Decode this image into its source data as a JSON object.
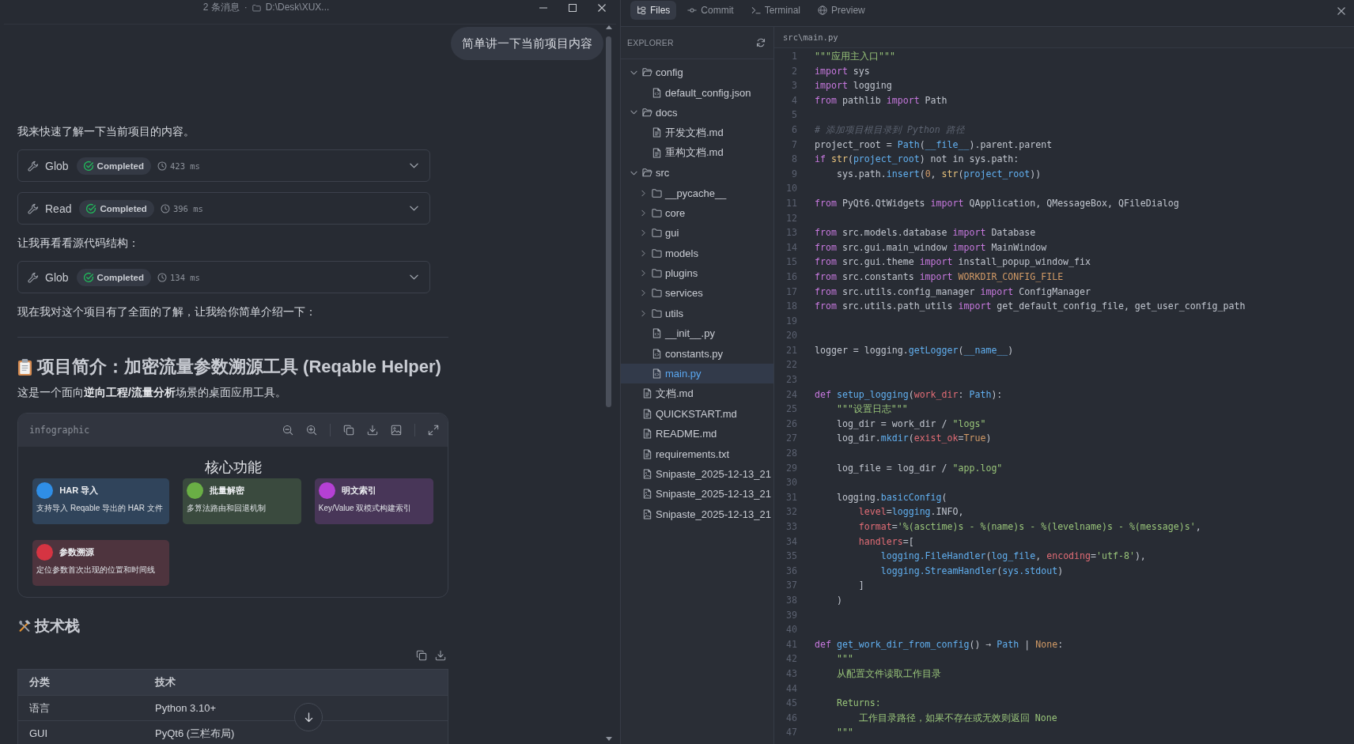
{
  "window": {
    "message_count": "2 条消息",
    "separator": "·",
    "path": "D:\\Desk\\XUX..."
  },
  "chat": {
    "user_message": "简单讲一下当前项目内容",
    "blocks": [
      {
        "kind": "text",
        "text": "我来快速了解一下当前项目的内容。"
      },
      {
        "kind": "tool",
        "name": "Glob",
        "status": "Completed",
        "duration": "423 ms",
        "expanded": false
      },
      {
        "kind": "tool",
        "name": "Read",
        "status": "Completed",
        "duration": "396 ms",
        "expanded": false
      },
      {
        "kind": "text",
        "text": "让我再看看源代码结构："
      },
      {
        "kind": "tool",
        "name": "Glob",
        "status": "Completed",
        "duration": "134 ms",
        "expanded": false
      },
      {
        "kind": "text",
        "text": "现在我对这个项目有了全面的了解，让我给你简单介绍一下："
      }
    ],
    "overview": {
      "heading": "项目简介：加密流量参数溯源工具 (Reqable Helper)",
      "intro": "这是一个面向**逆向工程/流量分析**场景的桌面应用工具。",
      "infographic": {
        "label": "infographic",
        "title": "核心功能",
        "features": [
          {
            "title": "HAR 导入",
            "description": "支持导入 Reqable 导出的 HAR 文件",
            "color": "#2f8ee6"
          },
          {
            "title": "批量解密",
            "description": "多算法路由和回退机制",
            "color": "#6aaf45"
          },
          {
            "title": "明文索引",
            "description": "Key/Value 双模式构建索引",
            "color": "#b540d4"
          },
          {
            "title": "参数溯源",
            "description": "定位参数首次出现的位置和时间线",
            "color": "#d63442"
          }
        ]
      }
    },
    "tech_stack": {
      "heading": "技术栈",
      "table": {
        "columns": [
          "分类",
          "技术"
        ],
        "rows": [
          [
            "语言",
            "Python 3.10+"
          ],
          [
            "GUI",
            "PyQt6 (三栏布局)"
          ]
        ]
      }
    }
  },
  "ide": {
    "tabs": [
      {
        "label": "Files",
        "selected": true
      },
      {
        "label": "Commit",
        "selected": false
      },
      {
        "label": "Terminal",
        "selected": false
      },
      {
        "label": "Preview",
        "selected": false
      }
    ],
    "explorer": {
      "title": "EXPLORER",
      "tree": [
        {
          "name": "config",
          "kind": "folder",
          "expanded": true,
          "selected": false,
          "children": [
            {
              "name": "default_config.json",
              "kind": "source",
              "selected": false
            }
          ]
        },
        {
          "name": "docs",
          "kind": "folder",
          "expanded": true,
          "selected": false,
          "children": [
            {
              "name": "开发文档.md",
              "kind": "document",
              "selected": false
            },
            {
              "name": "重构文档.md",
              "kind": "document",
              "selected": false
            }
          ]
        },
        {
          "name": "src",
          "kind": "folder",
          "expanded": true,
          "selected": false,
          "children": [
            {
              "name": "__pycache__",
              "kind": "folder",
              "expanded": false,
              "selected": false
            },
            {
              "name": "core",
              "kind": "folder",
              "expanded": false,
              "selected": false
            },
            {
              "name": "gui",
              "kind": "folder",
              "expanded": false,
              "selected": false
            },
            {
              "name": "models",
              "kind": "folder",
              "expanded": false,
              "selected": false
            },
            {
              "name": "plugins",
              "kind": "folder",
              "expanded": false,
              "selected": false
            },
            {
              "name": "services",
              "kind": "folder",
              "expanded": false,
              "selected": false
            },
            {
              "name": "utils",
              "kind": "folder",
              "expanded": false,
              "selected": false
            },
            {
              "name": "__init__.py",
              "kind": "source",
              "selected": false
            },
            {
              "name": "constants.py",
              "kind": "source",
              "selected": false
            },
            {
              "name": "main.py",
              "kind": "source",
              "selected": true
            }
          ]
        },
        {
          "name": "文档.md",
          "kind": "document",
          "selected": false
        },
        {
          "name": "QUICKSTART.md",
          "kind": "document",
          "selected": false
        },
        {
          "name": "README.md",
          "kind": "document",
          "selected": false
        },
        {
          "name": "requirements.txt",
          "kind": "document",
          "selected": false
        },
        {
          "name": "Snipaste_2025-12-13_21",
          "kind": "image",
          "selected": false
        },
        {
          "name": "Snipaste_2025-12-13_21",
          "kind": "image",
          "selected": false
        },
        {
          "name": "Snipaste_2025-12-13_21",
          "kind": "image",
          "selected": false
        }
      ]
    },
    "editor": {
      "path": "src\\main.py",
      "lines": [
        {
          "number": "1",
          "tokens": [
            {
              "text": "\"\"\"应用主入口\"\"\"",
              "kind": "string"
            }
          ]
        },
        {
          "number": "2",
          "tokens": [
            {
              "text": "import",
              "kind": "keyword"
            },
            {
              "text": " sys",
              "kind": "plain"
            }
          ]
        },
        {
          "number": "3",
          "tokens": [
            {
              "text": "import",
              "kind": "keyword"
            },
            {
              "text": " logging",
              "kind": "plain"
            }
          ]
        },
        {
          "number": "4",
          "tokens": [
            {
              "text": "from",
              "kind": "keyword"
            },
            {
              "text": " pathlib ",
              "kind": "plain"
            },
            {
              "text": "import",
              "kind": "keyword"
            },
            {
              "text": " Path",
              "kind": "plain"
            }
          ]
        },
        {
          "number": "5"
        },
        {
          "number": "6",
          "tokens": [
            {
              "text": "# 添加项目根目录到 Python 路径",
              "kind": "comment"
            }
          ]
        },
        {
          "number": "7",
          "tokens": [
            {
              "text": "project_root = ",
              "kind": "plain"
            },
            {
              "text": "Path",
              "kind": "function"
            },
            {
              "text": "(",
              "kind": "plain"
            },
            {
              "text": "__file__",
              "kind": "function"
            },
            {
              "text": ").parent.parent",
              "kind": "plain"
            }
          ]
        },
        {
          "number": "8",
          "tokens": [
            {
              "text": "if ",
              "kind": "keyword"
            },
            {
              "text": "str",
              "kind": "builtin"
            },
            {
              "text": "(",
              "kind": "plain"
            },
            {
              "text": "project_root",
              "kind": "function"
            },
            {
              "text": ") not in sys.path:",
              "kind": "plain"
            }
          ]
        },
        {
          "number": "9",
          "tokens": [
            {
              "text": "    sys.path.",
              "kind": "plain"
            },
            {
              "text": "insert",
              "kind": "function"
            },
            {
              "text": "(",
              "kind": "plain"
            },
            {
              "text": "0",
              "kind": "constant"
            },
            {
              "text": ", ",
              "kind": "plain"
            },
            {
              "text": "str",
              "kind": "builtin"
            },
            {
              "text": "(",
              "kind": "plain"
            },
            {
              "text": "project_root",
              "kind": "function"
            },
            {
              "text": "))",
              "kind": "plain"
            }
          ]
        },
        {
          "number": "10"
        },
        {
          "number": "11",
          "tokens": [
            {
              "text": "from",
              "kind": "keyword"
            },
            {
              "text": " PyQt6.QtWidgets ",
              "kind": "plain"
            },
            {
              "text": "import",
              "kind": "keyword"
            },
            {
              "text": " QApplication, QMessageBox, QFileDialog",
              "kind": "plain"
            }
          ]
        },
        {
          "number": "12"
        },
        {
          "number": "13",
          "tokens": [
            {
              "text": "from",
              "kind": "keyword"
            },
            {
              "text": " src.models.database ",
              "kind": "plain"
            },
            {
              "text": "import",
              "kind": "keyword"
            },
            {
              "text": " Database",
              "kind": "plain"
            }
          ]
        },
        {
          "number": "14",
          "tokens": [
            {
              "text": "from",
              "kind": "keyword"
            },
            {
              "text": " src.gui.main_window ",
              "kind": "plain"
            },
            {
              "text": "import",
              "kind": "keyword"
            },
            {
              "text": " MainWindow",
              "kind": "plain"
            }
          ]
        },
        {
          "number": "15",
          "tokens": [
            {
              "text": "from",
              "kind": "keyword"
            },
            {
              "text": " src.gui.theme ",
              "kind": "plain"
            },
            {
              "text": "import",
              "kind": "keyword"
            },
            {
              "text": " install_popup_window_fix",
              "kind": "plain"
            }
          ]
        },
        {
          "number": "16",
          "tokens": [
            {
              "text": "from",
              "kind": "keyword"
            },
            {
              "text": " src.constants ",
              "kind": "plain"
            },
            {
              "text": "import ",
              "kind": "keyword"
            },
            {
              "text": "WORKDIR_CONFIG_FILE",
              "kind": "constant"
            }
          ]
        },
        {
          "number": "17",
          "tokens": [
            {
              "text": "from",
              "kind": "keyword"
            },
            {
              "text": " src.utils.config_manager ",
              "kind": "plain"
            },
            {
              "text": "import",
              "kind": "keyword"
            },
            {
              "text": " ConfigManager",
              "kind": "plain"
            }
          ]
        },
        {
          "number": "18",
          "tokens": [
            {
              "text": "from",
              "kind": "keyword"
            },
            {
              "text": " src.utils.path_utils ",
              "kind": "plain"
            },
            {
              "text": "import",
              "kind": "keyword"
            },
            {
              "text": " get_default_config_file, get_user_config_path",
              "kind": "plain"
            }
          ]
        },
        {
          "number": "19"
        },
        {
          "number": "20"
        },
        {
          "number": "21",
          "tokens": [
            {
              "text": "logger = logging.",
              "kind": "plain"
            },
            {
              "text": "getLogger",
              "kind": "function"
            },
            {
              "text": "(",
              "kind": "plain"
            },
            {
              "text": "__name__",
              "kind": "function"
            },
            {
              "text": ")",
              "kind": "plain"
            }
          ]
        },
        {
          "number": "22"
        },
        {
          "number": "23"
        },
        {
          "number": "24",
          "tokens": [
            {
              "text": "def ",
              "kind": "keyword"
            },
            {
              "text": "setup_logging",
              "kind": "function"
            },
            {
              "text": "(",
              "kind": "plain"
            },
            {
              "text": "work_dir",
              "kind": "param"
            },
            {
              "text": ": ",
              "kind": "plain"
            },
            {
              "text": "Path",
              "kind": "function"
            },
            {
              "text": "):",
              "kind": "plain"
            }
          ]
        },
        {
          "number": "25",
          "tokens": [
            {
              "text": "    \"\"\"设置日志\"\"\"",
              "kind": "string"
            }
          ]
        },
        {
          "number": "26",
          "tokens": [
            {
              "text": "    log_dir = work_dir / ",
              "kind": "plain"
            },
            {
              "text": "\"logs\"",
              "kind": "string"
            }
          ]
        },
        {
          "number": "27",
          "tokens": [
            {
              "text": "    log_dir.",
              "kind": "plain"
            },
            {
              "text": "mkdir",
              "kind": "function"
            },
            {
              "text": "(",
              "kind": "plain"
            },
            {
              "text": "exist_ok",
              "kind": "param"
            },
            {
              "text": "=",
              "kind": "plain"
            },
            {
              "text": "True",
              "kind": "constant"
            },
            {
              "text": ")",
              "kind": "plain"
            }
          ]
        },
        {
          "number": "28"
        },
        {
          "number": "29",
          "tokens": [
            {
              "text": "    log_file = log_dir / ",
              "kind": "plain"
            },
            {
              "text": "\"app.log\"",
              "kind": "string"
            }
          ]
        },
        {
          "number": "30"
        },
        {
          "number": "31",
          "tokens": [
            {
              "text": "    logging.",
              "kind": "plain"
            },
            {
              "text": "basicConfig",
              "kind": "function"
            },
            {
              "text": "(",
              "kind": "plain"
            }
          ]
        },
        {
          "number": "32",
          "tokens": [
            {
              "text": "        level",
              "kind": "param"
            },
            {
              "text": "=",
              "kind": "plain"
            },
            {
              "text": "logging",
              "kind": "function"
            },
            {
              "text": ".INFO,",
              "kind": "plain"
            }
          ]
        },
        {
          "number": "33",
          "tokens": [
            {
              "text": "        format",
              "kind": "param"
            },
            {
              "text": "=",
              "kind": "plain"
            },
            {
              "text": "'%(asctime)s - %(name)s - %(levelname)s - %(message)s'",
              "kind": "string"
            },
            {
              "text": ",",
              "kind": "plain"
            }
          ]
        },
        {
          "number": "34",
          "tokens": [
            {
              "text": "        handlers",
              "kind": "param"
            },
            {
              "text": "=[",
              "kind": "plain"
            }
          ]
        },
        {
          "number": "35",
          "tokens": [
            {
              "text": "            logging.FileHandler",
              "kind": "function"
            },
            {
              "text": "(",
              "kind": "plain"
            },
            {
              "text": "log_file",
              "kind": "function"
            },
            {
              "text": ", ",
              "kind": "plain"
            },
            {
              "text": "encoding",
              "kind": "param"
            },
            {
              "text": "=",
              "kind": "plain"
            },
            {
              "text": "'utf-8'",
              "kind": "string"
            },
            {
              "text": "),",
              "kind": "plain"
            }
          ]
        },
        {
          "number": "36",
          "tokens": [
            {
              "text": "            logging.StreamHandler",
              "kind": "function"
            },
            {
              "text": "(",
              "kind": "plain"
            },
            {
              "text": "sys.stdout",
              "kind": "function"
            },
            {
              "text": ")",
              "kind": "plain"
            }
          ]
        },
        {
          "number": "37",
          "tokens": [
            {
              "text": "        ]",
              "kind": "plain"
            }
          ]
        },
        {
          "number": "38",
          "tokens": [
            {
              "text": "    )",
              "kind": "plain"
            }
          ]
        },
        {
          "number": "39"
        },
        {
          "number": "40"
        },
        {
          "number": "41",
          "tokens": [
            {
              "text": "def ",
              "kind": "keyword"
            },
            {
              "text": "get_work_dir_from_config",
              "kind": "function"
            },
            {
              "text": "() → ",
              "kind": "plain"
            },
            {
              "text": "Path",
              "kind": "function"
            },
            {
              "text": " | ",
              "kind": "plain"
            },
            {
              "text": "None",
              "kind": "constant"
            },
            {
              "text": ":",
              "kind": "plain"
            }
          ]
        },
        {
          "number": "42",
          "tokens": [
            {
              "text": "    \"\"\"",
              "kind": "string"
            }
          ]
        },
        {
          "number": "43",
          "tokens": [
            {
              "text": "    从配置文件读取工作目录",
              "kind": "string"
            }
          ]
        },
        {
          "number": "44"
        },
        {
          "number": "45",
          "tokens": [
            {
              "text": "    Returns:",
              "kind": "string"
            }
          ]
        },
        {
          "number": "46",
          "tokens": [
            {
              "text": "        工作目录路径，如果不存在或无效则返回 None",
              "kind": "string"
            }
          ]
        },
        {
          "number": "47",
          "tokens": [
            {
              "text": "    \"\"\"",
              "kind": "string"
            }
          ]
        }
      ]
    }
  }
}
